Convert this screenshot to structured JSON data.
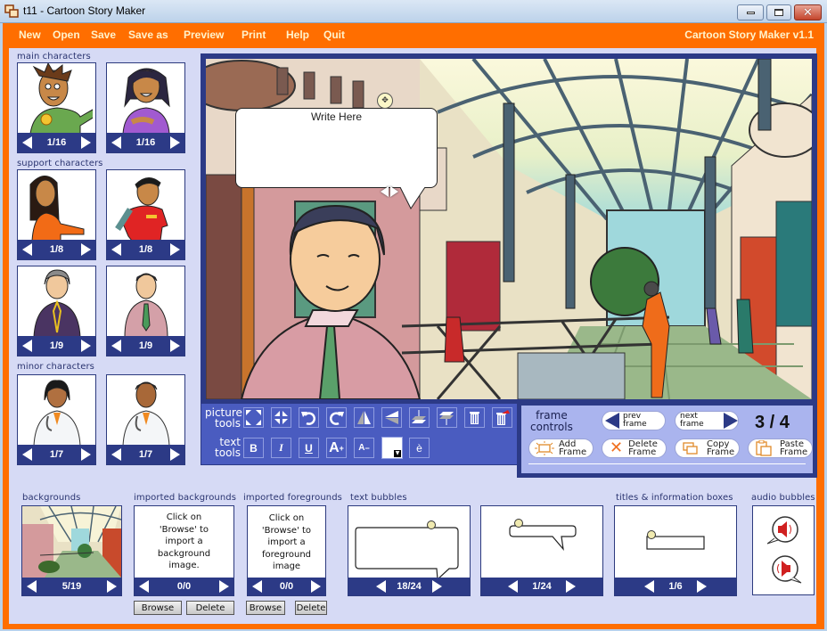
{
  "window": {
    "title": "t11 - Cartoon Story Maker",
    "controls": {
      "minimize": "minimize",
      "maximize": "maximize",
      "close": "close"
    }
  },
  "menu": {
    "items": [
      {
        "label": "New"
      },
      {
        "label": "Open"
      },
      {
        "label": "Save"
      },
      {
        "label": "Save as"
      },
      {
        "label": "Preview"
      },
      {
        "label": "Print"
      },
      {
        "label": "Help"
      },
      {
        "label": "Quit"
      }
    ],
    "brand": "Cartoon Story Maker v1.1"
  },
  "colors": {
    "accent_orange": "#ff6e00",
    "panel_navy": "#2c3a86",
    "tool_blue": "#4a5cc0",
    "content_bg": "#d6daf5"
  },
  "sidebar": {
    "main_characters": {
      "label": "main characters",
      "cards": [
        {
          "counter": "1/16",
          "image": "boy-green-shirt-character"
        },
        {
          "counter": "1/16",
          "image": "girl-purple-shirt-character"
        }
      ]
    },
    "support_characters": {
      "label": "support characters",
      "cards": [
        {
          "counter": "1/8",
          "image": "woman-orange-top-character"
        },
        {
          "counter": "1/8",
          "image": "boy-red-shirt-character"
        },
        {
          "counter": "1/9",
          "image": "grey-haired-woman-character"
        },
        {
          "counter": "1/9",
          "image": "man-pink-shirt-tie-character"
        }
      ]
    },
    "minor_characters": {
      "label": "minor characters",
      "cards": [
        {
          "counter": "1/7",
          "image": "female-doctor-character"
        },
        {
          "counter": "1/7",
          "image": "male-doctor-character"
        }
      ]
    }
  },
  "canvas": {
    "background": "shopping-mall-arcade",
    "character": "man-pink-shirt-tie-character",
    "bubble_text": "Write Here"
  },
  "tools": {
    "picture_label_1": "picture",
    "picture_label_2": "tools",
    "text_label_1": "text",
    "text_label_2": "tools",
    "picture_tools": [
      "enlarge",
      "shrink",
      "rotate-left",
      "rotate-right",
      "flip-horizontal",
      "flip-vertical",
      "bring-forward",
      "send-backward",
      "delete",
      "delete-all"
    ],
    "text_tools": {
      "bold": "B",
      "italic": "I",
      "underline": "U",
      "font_bigger": "A",
      "font_smaller": "A",
      "accent": "è"
    },
    "text_color": "#ffffff"
  },
  "frame_controls": {
    "label_1": "frame",
    "label_2": "controls",
    "prev": "prev frame",
    "next": "next frame",
    "current": 3,
    "total": 4,
    "counter_text": "3 / 4",
    "add": [
      "Add",
      "Frame"
    ],
    "delete": [
      "Delete",
      "Frame"
    ],
    "copy": [
      "Copy",
      "Frame"
    ],
    "paste": [
      "Paste",
      "Frame"
    ]
  },
  "bottom": {
    "backgrounds": {
      "label": "backgrounds",
      "counter": "5/19"
    },
    "imported_backgrounds": {
      "label": "imported backgrounds",
      "text": [
        "Click on",
        "'Browse' to",
        "import a",
        "background",
        "image."
      ],
      "counter": "0/0",
      "browse": "Browse",
      "delete": "Delete"
    },
    "imported_foregrounds": {
      "label": "imported foregrounds",
      "text": [
        "Click on",
        "'Browse' to",
        "import a",
        "foreground",
        "image"
      ],
      "counter": "0/0",
      "browse": "Browse",
      "delete": "Delete"
    },
    "text_bubbles": {
      "label": "text bubbles",
      "cards": [
        {
          "counter": "18/24"
        },
        {
          "counter": "1/24"
        }
      ]
    },
    "titles": {
      "label": "titles & information boxes",
      "counter": "1/6"
    },
    "audio": {
      "label": "audio bubbles"
    }
  }
}
